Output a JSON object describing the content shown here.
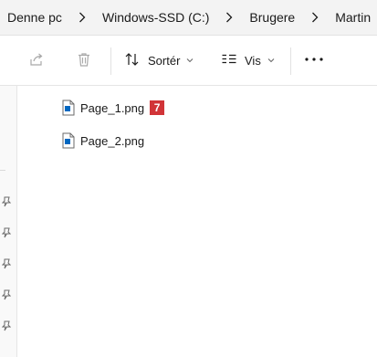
{
  "breadcrumb": {
    "items": [
      {
        "label": "Denne pc"
      },
      {
        "label": "Windows-SSD (C:)"
      },
      {
        "label": "Brugere"
      },
      {
        "label": "Martin"
      }
    ]
  },
  "toolbar": {
    "share_icon": "share-icon",
    "delete_icon": "trash-icon",
    "sort_label": "Sortér",
    "view_label": "Vis",
    "more_icon": "more-icon"
  },
  "files": [
    {
      "name": "Page_1.png",
      "badge": "7"
    },
    {
      "name": "Page_2.png"
    }
  ],
  "colors": {
    "accent": "#0067c0",
    "badge": "#d13438",
    "addressbar_bg": "#f3f3f3"
  }
}
